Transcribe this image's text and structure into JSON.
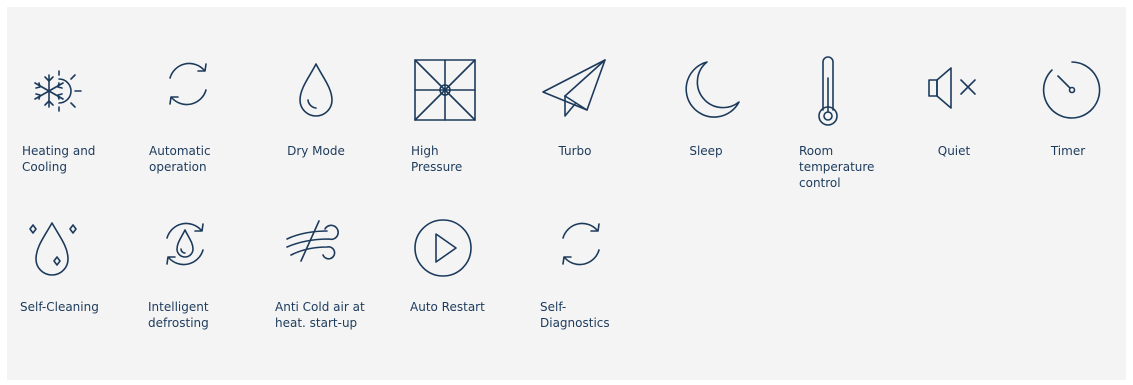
{
  "colors": {
    "icon_stroke": "#1c3a5b",
    "label_text": "#1c3a5b",
    "panel_background": "#f4f4f4"
  },
  "features": [
    {
      "icon": "heating-cooling-icon",
      "label_lines": [
        "Heating and",
        "Cooling"
      ]
    },
    {
      "icon": "automatic-operation-icon",
      "label_lines": [
        "Automatic",
        "operation"
      ]
    },
    {
      "icon": "dry-mode-icon",
      "label_lines": [
        "Dry Mode"
      ]
    },
    {
      "icon": "high-pressure-icon",
      "label_lines": [
        "High",
        "Pressure"
      ]
    },
    {
      "icon": "turbo-icon",
      "label_lines": [
        "Turbo"
      ]
    },
    {
      "icon": "sleep-icon",
      "label_lines": [
        "Sleep"
      ]
    },
    {
      "icon": "room-temperature-icon",
      "label_lines": [
        "Room",
        "temperature",
        "control"
      ]
    },
    {
      "icon": "quiet-icon",
      "label_lines": [
        "Quiet"
      ]
    },
    {
      "icon": "timer-icon",
      "label_lines": [
        "Timer"
      ]
    },
    {
      "icon": "self-cleaning-icon",
      "label_lines": [
        "Self-Cleaning"
      ]
    },
    {
      "icon": "intelligent-defrosting-icon",
      "label_lines": [
        "Intelligent",
        "defrosting"
      ]
    },
    {
      "icon": "anti-cold-air-icon",
      "label_lines": [
        "Anti Cold air at",
        "heat. start-up"
      ]
    },
    {
      "icon": "auto-restart-icon",
      "label_lines": [
        "Auto Restart"
      ]
    },
    {
      "icon": "self-diagnostics-icon",
      "label_lines": [
        "Self-",
        "Diagnostics"
      ]
    }
  ]
}
